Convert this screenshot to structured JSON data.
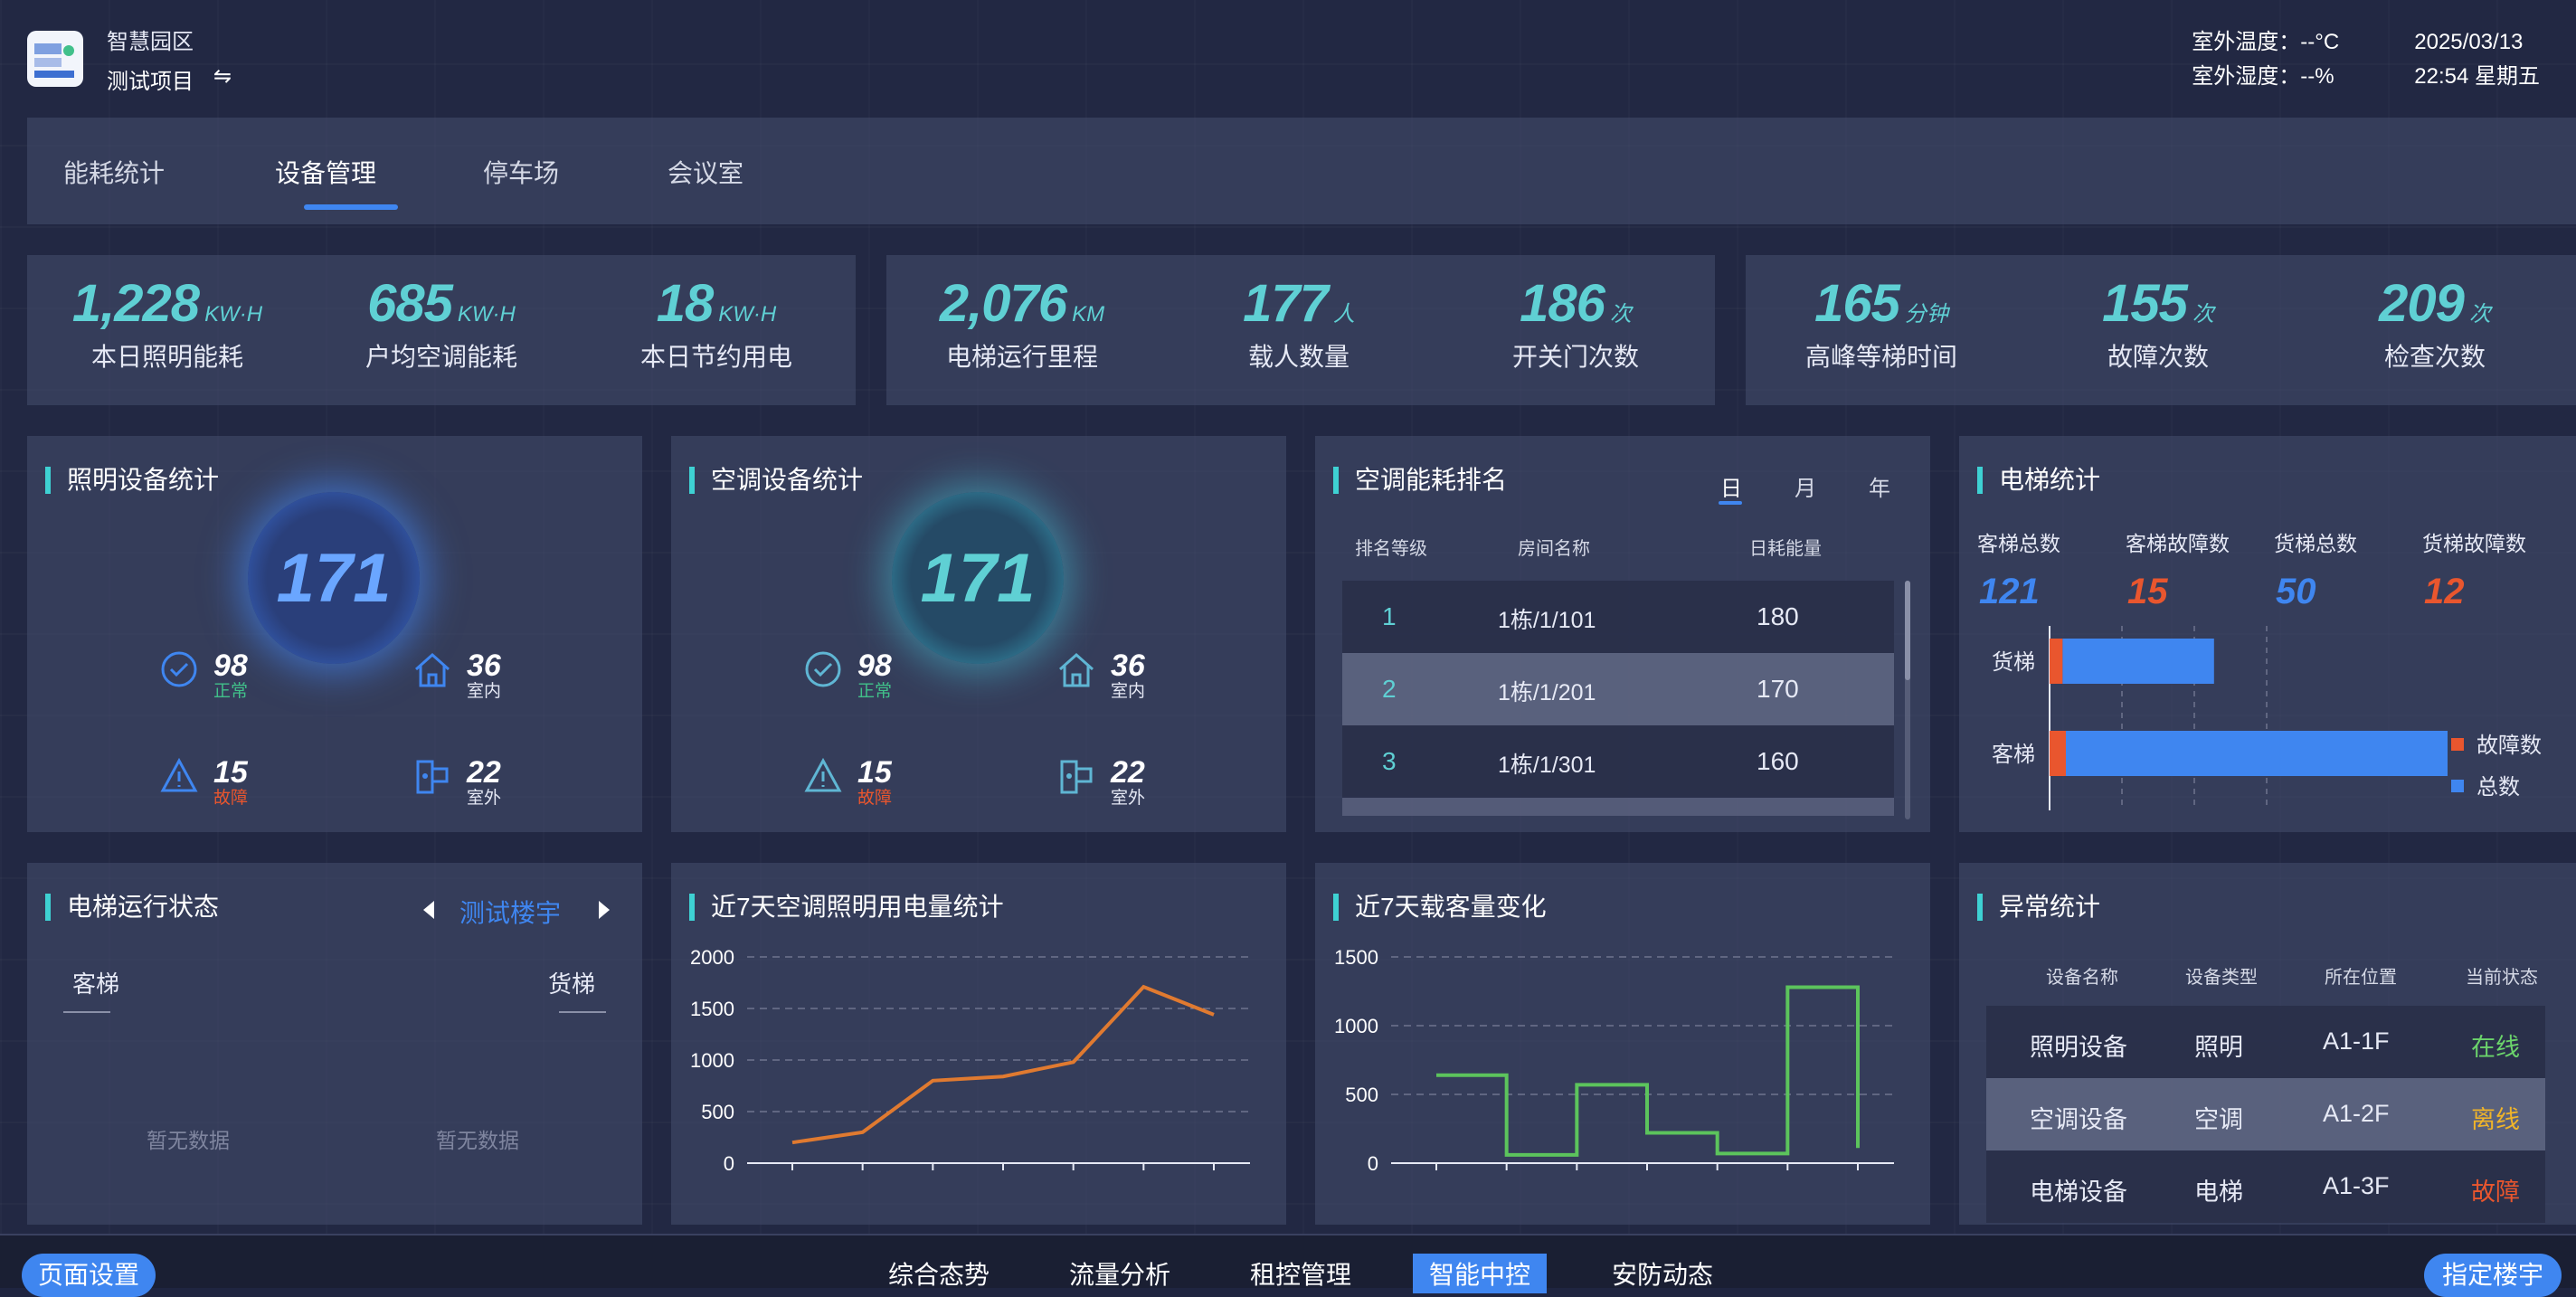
{
  "header": {
    "park_name": "智慧园区",
    "project_name": "测试项目",
    "switch_symbol": "⇋",
    "temp_label": "室外温度：--°C",
    "date": "2025/03/13",
    "humidity_label": "室外湿度：--%",
    "time_weekday": "22:54 星期五"
  },
  "tabs": [
    "能耗统计",
    "设备管理",
    "停车场",
    "会议室"
  ],
  "kpi": [
    {
      "value": "1,228",
      "unit": "KW·H",
      "label": "本日照明能耗"
    },
    {
      "value": "685",
      "unit": "KW·H",
      "label": "户均空调能耗"
    },
    {
      "value": "18",
      "unit": "KW·H",
      "label": "本日节约用电"
    },
    {
      "value": "2,076",
      "unit": "KM",
      "label": "电梯运行里程"
    },
    {
      "value": "177",
      "unit": "人",
      "label": "载人数量"
    },
    {
      "value": "186",
      "unit": "次",
      "label": "开关门次数"
    },
    {
      "value": "165",
      "unit": "分钟",
      "label": "高峰等梯时间"
    },
    {
      "value": "155",
      "unit": "次",
      "label": "故障次数"
    },
    {
      "value": "209",
      "unit": "次",
      "label": "检查次数"
    }
  ],
  "lighting": {
    "title": "照明设备统计",
    "total": "171",
    "normal": "98",
    "normal_label": "正常",
    "indoor": "36",
    "indoor_label": "室内",
    "fault": "15",
    "fault_label": "故障",
    "outdoor": "22",
    "outdoor_label": "室外"
  },
  "aircon": {
    "title": "空调设备统计",
    "total": "171",
    "normal": "98",
    "normal_label": "正常",
    "indoor": "36",
    "indoor_label": "室内",
    "fault": "15",
    "fault_label": "故障",
    "outdoor": "22",
    "outdoor_label": "室外"
  },
  "ranking": {
    "title": "空调能耗排名",
    "ranges": [
      "日",
      "月",
      "年"
    ],
    "active_range": "日",
    "headers": [
      "排名等级",
      "房间名称",
      "日耗能量"
    ],
    "rows": [
      {
        "rank": "1",
        "room": "1栋/1/101",
        "energy": "180"
      },
      {
        "rank": "2",
        "room": "1栋/1/201",
        "energy": "170"
      },
      {
        "rank": "3",
        "room": "1栋/1/301",
        "energy": "160"
      }
    ]
  },
  "elevator_stats": {
    "title": "电梯统计",
    "labels": [
      "客梯总数",
      "客梯故障数",
      "货梯总数",
      "货梯故障数"
    ],
    "values": [
      "121",
      "15",
      "50",
      "12"
    ],
    "colors": [
      "#3f86f0",
      "#e9562e",
      "#3f86f0",
      "#e9562e"
    ],
    "legend_fault": "故障数",
    "legend_total": "总数"
  },
  "elevator_status": {
    "title": "电梯运行状态",
    "building": "测试楼宇",
    "left_label": "客梯",
    "right_label": "货梯",
    "empty_left": "暂无数据",
    "empty_right": "暂无数据"
  },
  "power_chart_title": "近7天空调照明用电量统计",
  "passenger_chart_title": "近7天载客量变化",
  "anomaly": {
    "title": "异常统计",
    "headers": [
      "设备名称",
      "设备类型",
      "所在位置",
      "当前状态"
    ],
    "rows": [
      {
        "name": "照明设备",
        "type": "照明",
        "loc": "A1-1F",
        "status": "在线",
        "color": "#6bd36b"
      },
      {
        "name": "空调设备",
        "type": "空调",
        "loc": "A1-2F",
        "status": "离线",
        "color": "#f0b429"
      },
      {
        "name": "电梯设备",
        "type": "电梯",
        "loc": "A1-3F",
        "status": "故障",
        "color": "#e9562e"
      }
    ]
  },
  "bottom": {
    "page_settings": "页面设置",
    "nav": [
      "综合态势",
      "流量分析",
      "租控管理",
      "智能中控",
      "安防动态"
    ],
    "active_nav": "智能中控",
    "specify_building": "指定楼宇"
  },
  "chart_data": [
    {
      "type": "bar",
      "orientation": "horizontal",
      "stacked": true,
      "categories": [
        "货梯",
        "客梯"
      ],
      "series": [
        {
          "name": "故障数",
          "values": [
            12,
            15
          ],
          "color": "#e9562e"
        },
        {
          "name": "总数",
          "values": [
            50,
            121
          ],
          "color": "#3f86f0"
        }
      ],
      "legend": "right"
    },
    {
      "type": "line",
      "x": [
        1,
        2,
        3,
        4,
        5,
        6,
        7
      ],
      "series": [
        {
          "values": [
            200,
            300,
            800,
            840,
            980,
            1710,
            1440
          ],
          "color": "#e07a30"
        }
      ],
      "ylim": [
        0,
        2000
      ],
      "yticks": [
        0,
        500,
        1000,
        1500,
        2000
      ],
      "grid": true
    },
    {
      "type": "line",
      "step": true,
      "x": [
        1,
        2,
        3,
        4,
        5,
        6,
        7
      ],
      "series": [
        {
          "values": [
            640,
            60,
            570,
            220,
            70,
            1280,
            110
          ],
          "color": "#5cc45c"
        }
      ],
      "ylim": [
        0,
        1500
      ],
      "yticks": [
        0,
        500,
        1000,
        1500
      ],
      "grid": true
    }
  ]
}
